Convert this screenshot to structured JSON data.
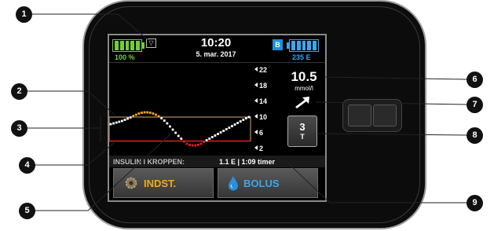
{
  "status_bar": {
    "battery_percent": "100 %",
    "time": "10:20",
    "date": "5. mar. 2017",
    "bolus_badge": "B",
    "insulin_remaining": "235 E"
  },
  "graph": {
    "y_axis_labels": [
      "22",
      "18",
      "14",
      "10",
      "6",
      "2"
    ],
    "target_range": [
      3.9,
      10.0
    ],
    "points": [
      8.2,
      8.4,
      8.6,
      8.8,
      9.0,
      9.3,
      9.6,
      9.9,
      10.3,
      10.6,
      10.9,
      11.1,
      11.2,
      11.2,
      11.1,
      10.9,
      10.6,
      10.2,
      9.7,
      9.1,
      8.4,
      7.6,
      6.8,
      6.0,
      5.2,
      4.5,
      3.8,
      3.2,
      2.9,
      2.8,
      2.8,
      2.9,
      3.2,
      3.7,
      4.1,
      4.5,
      4.9,
      5.3,
      5.7,
      6.1,
      6.5,
      6.9,
      7.3,
      7.7,
      8.1,
      8.5,
      8.9,
      9.3,
      9.7,
      10.0
    ]
  },
  "readout": {
    "bg_value": "10.5",
    "bg_unit": "mmol/l",
    "trend": "rising-arrow-icon",
    "hours_value": "3",
    "hours_unit": "T"
  },
  "iob": {
    "label": "INSULIN I KROPPEN:",
    "value": "1.1 E | 1:09 timer"
  },
  "buttons": {
    "options_label": "INDST.",
    "bolus_label": "BOLUS"
  },
  "callouts": [
    "1",
    "2",
    "3",
    "4",
    "5",
    "6",
    "7",
    "8",
    "9"
  ],
  "colors": {
    "battery": "#6fcf3a",
    "insulin": "#3aa7f0",
    "options": "#f5a623",
    "high": "#f5a623",
    "low": "#e02020",
    "in_range": "#ffffff"
  }
}
